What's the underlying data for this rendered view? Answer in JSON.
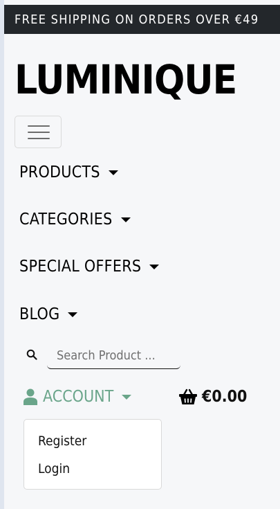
{
  "topbar": {
    "text": "FREE SHIPPING ON ORDERS OVER €49"
  },
  "brand": {
    "logo": "LUMINIQUE"
  },
  "nav": {
    "items": [
      {
        "label": "PRODUCTS"
      },
      {
        "label": "CATEGORIES"
      },
      {
        "label": "SPECIAL OFFERS"
      },
      {
        "label": "BLOG"
      }
    ]
  },
  "search": {
    "placeholder": "Search Product ...",
    "icon": "search-icon"
  },
  "account": {
    "label": "ACCOUNT",
    "icon": "user-icon",
    "color": "#6aa58a",
    "menu": [
      {
        "label": "Register"
      },
      {
        "label": "Login"
      }
    ]
  },
  "cart": {
    "total": "€0.00",
    "icon": "basket-icon"
  },
  "colors": {
    "topbar_bg": "#23272b",
    "page_bg": "#f6f7f9",
    "accent": "#6aa58a"
  }
}
